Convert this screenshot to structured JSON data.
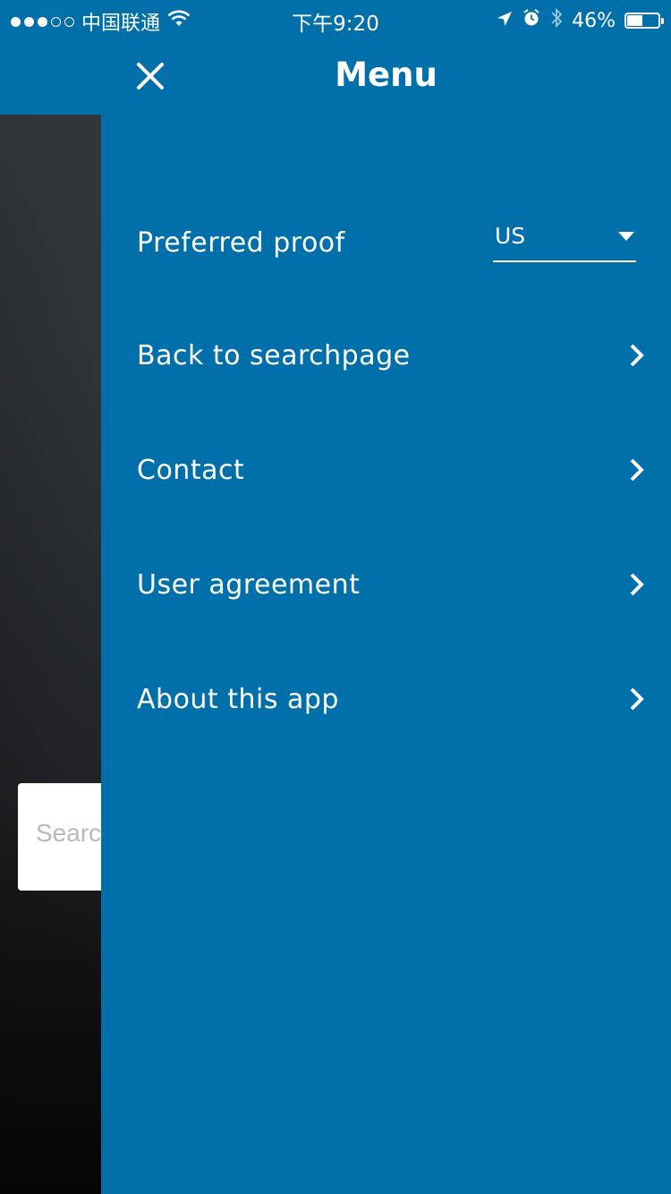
{
  "status_bar": {
    "carrier": "中国联通",
    "time": "下午9:20",
    "battery": "46%",
    "battery_level": 0.46,
    "icons": [
      "signal-dots-icon",
      "wifi-icon",
      "location-arrow-icon",
      "alarm-icon",
      "bluetooth-icon",
      "battery-icon"
    ]
  },
  "background": {
    "search_placeholder": "Searc"
  },
  "menu": {
    "title": "Menu",
    "close_icon": "close-icon",
    "preferred_proof": {
      "label": "Preferred proof",
      "selected": "US"
    },
    "items": [
      {
        "label": "Back to searchpage",
        "icon": "chevron-right-icon"
      },
      {
        "label": "Contact",
        "icon": "chevron-right-icon"
      },
      {
        "label": "User agreement",
        "icon": "chevron-right-icon"
      },
      {
        "label": "About this app",
        "icon": "chevron-right-icon"
      }
    ]
  },
  "colors": {
    "drawer_bg": "#0170aa",
    "text": "#ffffff"
  }
}
